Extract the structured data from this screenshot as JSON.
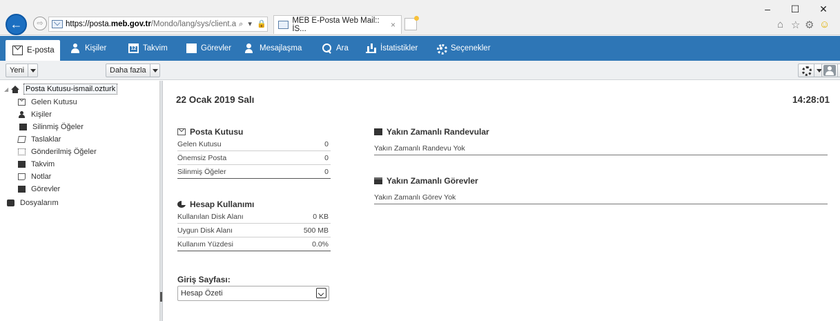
{
  "browser": {
    "url_prefix": "https://posta.",
    "url_domain": "meb.gov.tr",
    "url_rest": "/Mondo/lang/sys/client.a",
    "url_controls": "⌕ ▾ 🔒 ↻",
    "tab_title": "MEB E-Posta Web Mail:: İS...",
    "tab_close": "×",
    "back_glyph": "←",
    "forward_glyph": "⇨",
    "minimize": "–",
    "maximize": "☐",
    "close": "✕",
    "tools": [
      "⌂",
      "☆",
      "⚙",
      "☺"
    ]
  },
  "nav": {
    "items": [
      {
        "label": "E-posta",
        "icon": "mail-icon",
        "active": true
      },
      {
        "label": "Kişiler",
        "icon": "person-icon"
      },
      {
        "label": "Takvim",
        "icon": "calendar-icon",
        "badge": "12"
      },
      {
        "label": "Görevler",
        "icon": "task-icon"
      },
      {
        "label": "Mesajlaşma",
        "icon": "chat-icon"
      },
      {
        "label": "Ara",
        "icon": "search-icon"
      },
      {
        "label": "İstatistikler",
        "icon": "stats-icon"
      },
      {
        "label": "Seçenekler",
        "icon": "gear-icon"
      }
    ]
  },
  "toolbar": {
    "new_label": "Yeni",
    "more_label": "Daha fazla"
  },
  "sidebar": {
    "root_label": "Posta Kutusu-ismail.ozturk",
    "folders": [
      {
        "label": "Gelen Kutusu",
        "icon": "inbox-icon"
      },
      {
        "label": "Kişiler",
        "icon": "contacts-icon"
      },
      {
        "label": "Silinmiş Öğeler",
        "icon": "trash-icon"
      },
      {
        "label": "Taslaklar",
        "icon": "drafts-icon"
      },
      {
        "label": "Gönderilmiş Öğeler",
        "icon": "sent-icon"
      },
      {
        "label": "Takvim",
        "icon": "calendar-icon"
      },
      {
        "label": "Notlar",
        "icon": "notes-icon"
      },
      {
        "label": "Görevler",
        "icon": "tasks-icon"
      }
    ],
    "drive_label": "Dosyalarım"
  },
  "main": {
    "date": "22 Ocak 2019 Salı",
    "time": "14:28:01",
    "mailbox": {
      "title": "Posta Kutusu",
      "rows": [
        {
          "label": "Gelen Kutusu",
          "value": "0"
        },
        {
          "label": "Önemsiz Posta",
          "value": "0"
        },
        {
          "label": "Silinmiş Öğeler",
          "value": "0"
        }
      ]
    },
    "usage": {
      "title": "Hesap Kullanımı",
      "rows": [
        {
          "label": "Kullanılan Disk Alanı",
          "value": "0 KB"
        },
        {
          "label": "Uygun Disk Alanı",
          "value": "500 MB"
        },
        {
          "label": "Kullanım Yüzdesi",
          "value": "0.0%"
        }
      ]
    },
    "appointments": {
      "title": "Yakın Zamanlı Randevular",
      "empty": "Yakın Zamanlı Randevu Yok"
    },
    "tasks": {
      "title": "Yakın Zamanlı Görevler",
      "empty": "Yakın Zamanlı Görev Yok"
    },
    "start_page": {
      "label": "Giriş Sayfası:",
      "selected": "Hesap Özeti"
    }
  },
  "colors": {
    "nav_bg": "#2e76b6",
    "toolbar_bg": "#eef0f2",
    "back_button": "#1c6fc1"
  }
}
